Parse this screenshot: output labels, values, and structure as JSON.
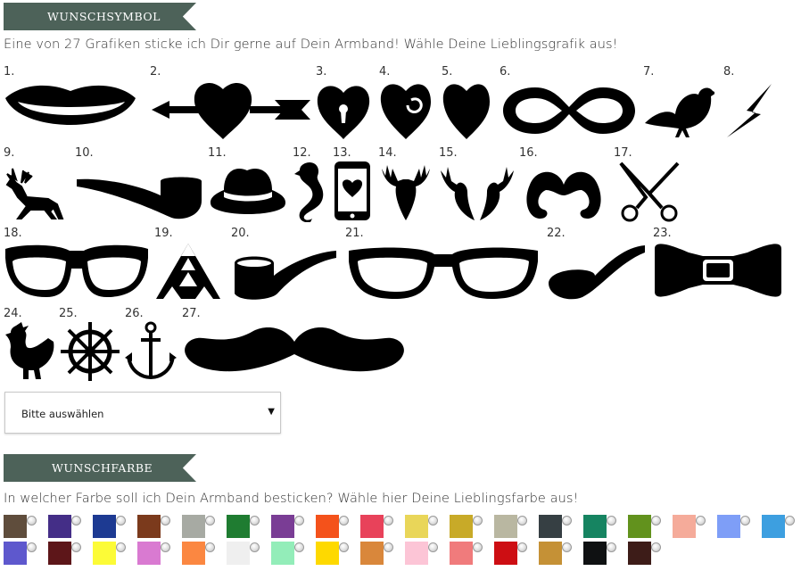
{
  "symbol_section": {
    "title": "WUNSCHSYMBOL",
    "intro": "Eine von 27 Grafiken sticke ich Dir gerne auf Dein Armband! Wähle Deine Lieblingsgrafik aus!",
    "symbols": [
      {
        "num": "1.",
        "icon": "lips-icon"
      },
      {
        "num": "2.",
        "icon": "heart-arrow-icon"
      },
      {
        "num": "3.",
        "icon": "heart-lock-icon"
      },
      {
        "num": "4.",
        "icon": "heart-swirl-icon"
      },
      {
        "num": "5.",
        "icon": "heart-icon"
      },
      {
        "num": "6.",
        "icon": "infinity-icon"
      },
      {
        "num": "7.",
        "icon": "bird-icon"
      },
      {
        "num": "8.",
        "icon": "lightning-icon"
      },
      {
        "num": "9.",
        "icon": "deer-icon"
      },
      {
        "num": "10.",
        "icon": "pipe-icon"
      },
      {
        "num": "11.",
        "icon": "fedora-hat-icon"
      },
      {
        "num": "12.",
        "icon": "seahorse-icon"
      },
      {
        "num": "13.",
        "icon": "phone-heart-icon"
      },
      {
        "num": "14.",
        "icon": "stag-head-icon"
      },
      {
        "num": "15.",
        "icon": "two-deer-heads-icon"
      },
      {
        "num": "16.",
        "icon": "mustache-curly-icon"
      },
      {
        "num": "17.",
        "icon": "scissors-icon"
      },
      {
        "num": "18.",
        "icon": "glasses-wayfarer-icon"
      },
      {
        "num": "19.",
        "icon": "triangle-icon"
      },
      {
        "num": "20.",
        "icon": "tobacco-pipe-icon"
      },
      {
        "num": "21.",
        "icon": "glasses-frame-icon"
      },
      {
        "num": "22.",
        "icon": "pipe-small-icon"
      },
      {
        "num": "23.",
        "icon": "bow-tie-icon"
      },
      {
        "num": "24.",
        "icon": "rooster-icon"
      },
      {
        "num": "25.",
        "icon": "ship-wheel-icon"
      },
      {
        "num": "26.",
        "icon": "anchor-icon"
      },
      {
        "num": "27.",
        "icon": "mustache-large-icon"
      }
    ],
    "select_value": "Bitte auswählen"
  },
  "color_section": {
    "title": "WUNSCHFARBE",
    "intro": "In welcher Farbe soll ich Dein Armband besticken? Wähle hier Deine Lieblingsfarbe aus!",
    "colors": [
      "#5f4d3c",
      "#442e87",
      "#1d3a92",
      "#7b3a1c",
      "#a7aaa3",
      "#1f7c31",
      "#7a3d95",
      "#f4521b",
      "#e8425a",
      "#e9d659",
      "#c8aa28",
      "#b9b7a1",
      "#363f43",
      "#168461",
      "#62921d",
      "#f5ab9a",
      "#7e9ef7",
      "#3d9fe0",
      "#5e58cd",
      "#5d1619",
      "#fcfb37",
      "#d97ad1",
      "#fb8741",
      "#efefef",
      "#93edb9",
      "#fed900",
      "#d9873b",
      "#fcc5d6",
      "#f07b7c",
      "#cd0e13",
      "#c59136",
      "#0f1112",
      "#3d1c18"
    ]
  }
}
